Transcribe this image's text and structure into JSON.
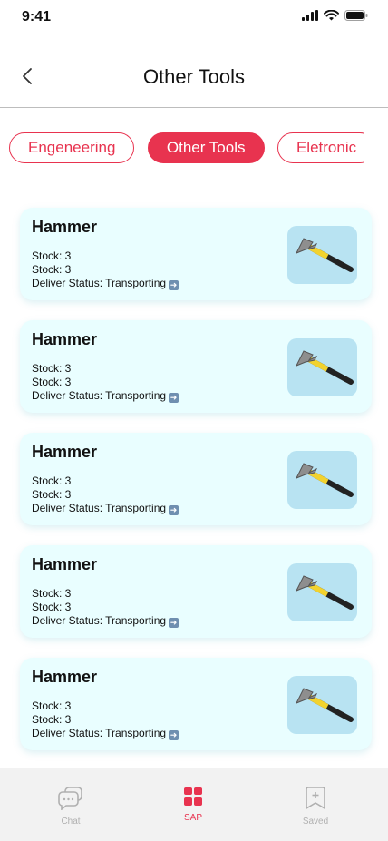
{
  "status_bar": {
    "time": "9:41"
  },
  "header": {
    "title": "Other Tools"
  },
  "tabs": [
    {
      "label": "Engeneering",
      "active": false
    },
    {
      "label": "Other Tools",
      "active": true
    },
    {
      "label": "Eletronic",
      "active": false
    }
  ],
  "items": [
    {
      "name": "Hammer",
      "stock1": "Stock: 3",
      "stock2": "Stock: 3",
      "status": "Deliver Status: Transporting"
    },
    {
      "name": "Hammer",
      "stock1": "Stock: 3",
      "stock2": "Stock: 3",
      "status": "Deliver Status: Transporting"
    },
    {
      "name": "Hammer",
      "stock1": "Stock: 3",
      "stock2": "Stock: 3",
      "status": "Deliver Status: Transporting"
    },
    {
      "name": "Hammer",
      "stock1": "Stock: 3",
      "stock2": "Stock: 3",
      "status": "Deliver Status: Transporting"
    },
    {
      "name": "Hammer",
      "stock1": "Stock: 3",
      "stock2": "Stock: 3",
      "status": "Deliver Status: Transporting"
    }
  ],
  "bottom_nav": {
    "chat": "Chat",
    "sap": "SAP",
    "saved": "Saved"
  },
  "colors": {
    "accent": "#e8334f",
    "card_bg": "#e9feff",
    "thumb_bg": "#b8e3f2",
    "nav_bg": "#f2f2f2"
  }
}
